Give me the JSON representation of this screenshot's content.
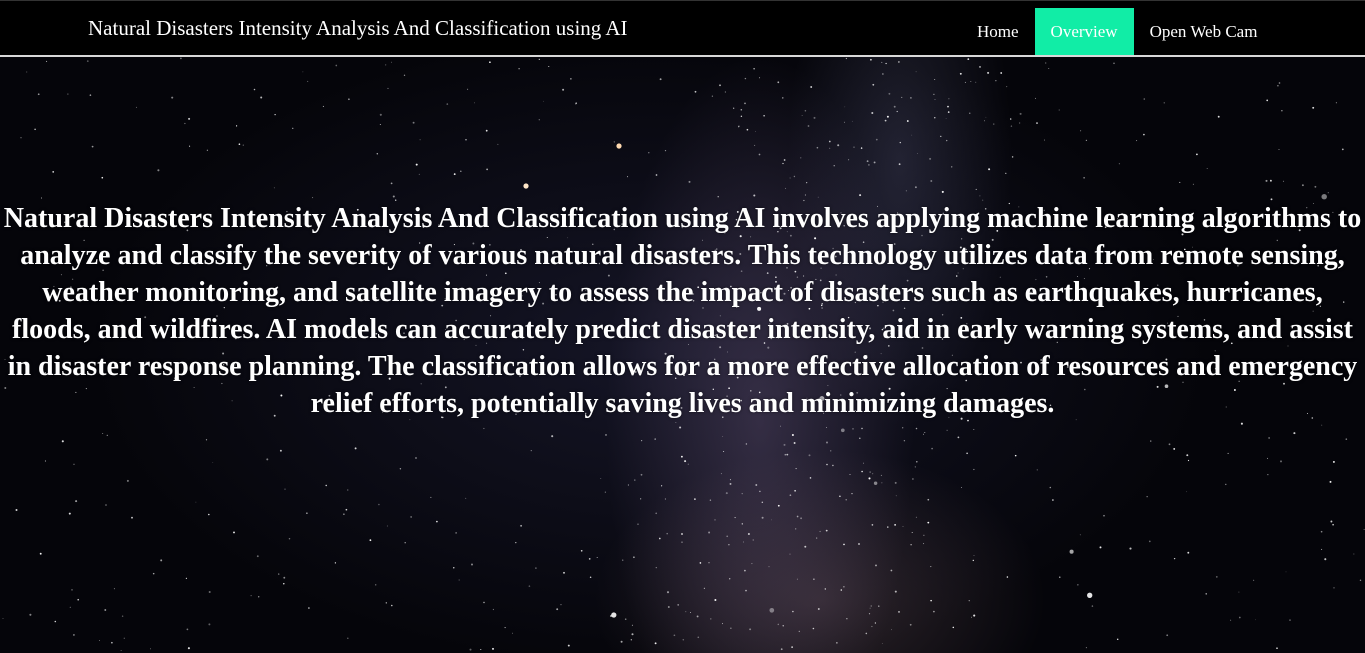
{
  "navbar": {
    "brand": "Natural Disasters Intensity Analysis And Classification using AI",
    "links": [
      {
        "label": "Home",
        "active": false
      },
      {
        "label": "Overview",
        "active": true
      },
      {
        "label": "Open Web Cam",
        "active": false
      }
    ],
    "active_color": "#11eda6",
    "background_color": "#000000"
  },
  "main": {
    "description": "Natural Disasters Intensity Analysis And Classification using AI involves applying machine learning algorithms to analyze and classify the severity of various natural disasters. This technology utilizes data from remote sensing, weather monitoring, and satellite imagery to assess the impact of disasters such as earthquakes, hurricanes, floods, and wildfires. AI models can accurately predict disaster intensity, aid in early warning systems, and assist in disaster response planning. The classification allows for a more effective allocation of resources and emergency relief efforts, potentially saving lives and minimizing damages.",
    "background": "starry-night-sky-image"
  }
}
